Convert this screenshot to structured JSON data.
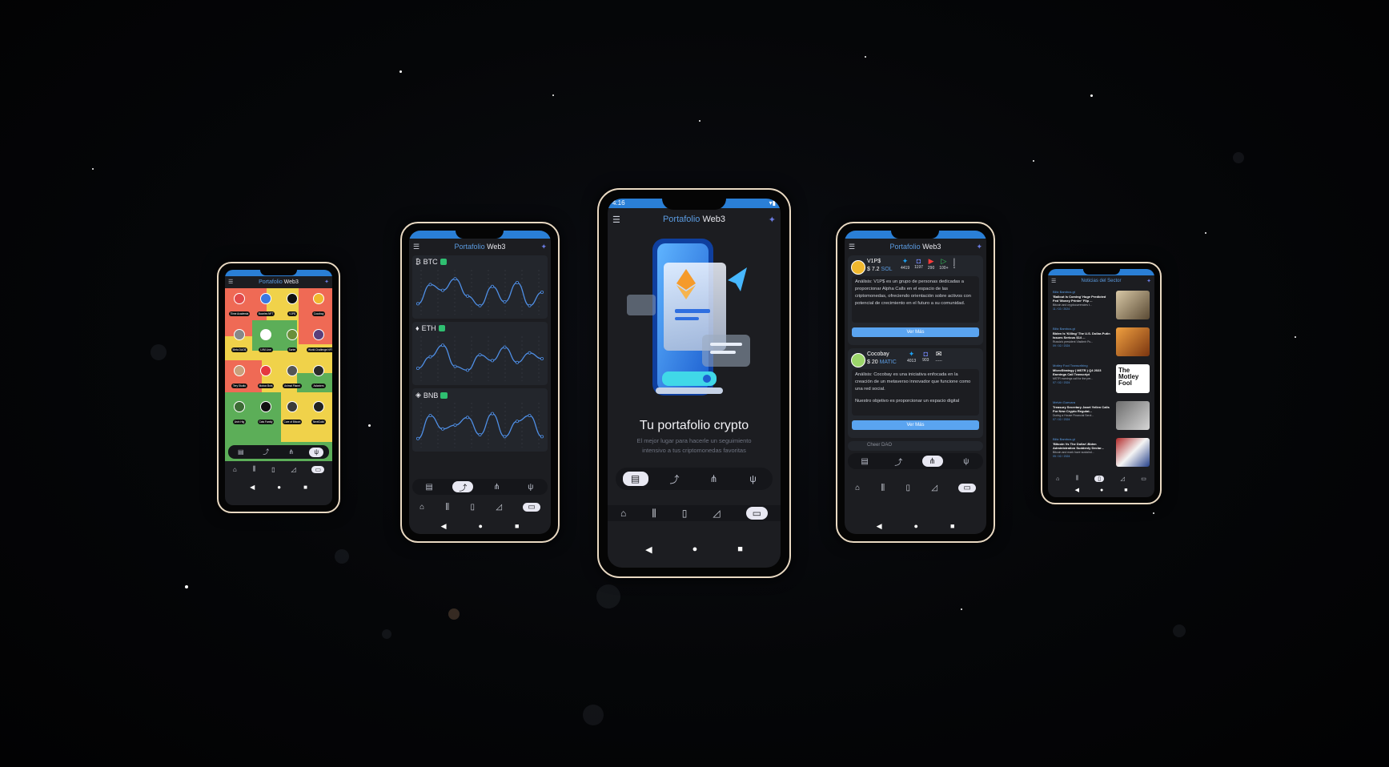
{
  "app": {
    "title_part1": "Portafolio",
    "title_part2": "Web3"
  },
  "phone_left": {
    "nfts": [
      {
        "name": "Tiime Academia"
      },
      {
        "name": "Boonies NFT"
      },
      {
        "name": "V1P$"
      },
      {
        "name": "Cocobay"
      },
      {
        "name": "Meta DAO$"
      },
      {
        "name": "LVM Line"
      },
      {
        "name": "Sorter"
      },
      {
        "name": "World Challenge NFT"
      },
      {
        "name": "Tery Studio"
      },
      {
        "name": "Mobox Bots"
      },
      {
        "name": "Animal Planet"
      },
      {
        "name": "Aslaniers"
      },
      {
        "name": "Arch Hig"
      },
      {
        "name": "Cats Family"
      },
      {
        "name": "Core of Bitcoin"
      },
      {
        "name": "NextGuild"
      }
    ]
  },
  "phone_charts": {
    "coins": [
      {
        "symbol": "BTC",
        "glyph": "₿"
      },
      {
        "symbol": "ETH",
        "glyph": "♦"
      },
      {
        "symbol": "BNB",
        "glyph": "◈"
      }
    ]
  },
  "phone_center": {
    "time": "4:16",
    "heading": "Tu portafolio crypto",
    "subtitle_line1": "El mejor lugar para hacerle un seguimiento",
    "subtitle_line2": "intensivo a tus criptomonedas favoritas"
  },
  "phone_projects": {
    "projects": [
      {
        "name": "V1P$",
        "price": "$ 7.2",
        "chain": "SOL",
        "twitter": "4419",
        "discord": "1197",
        "youtube": "290",
        "play": "100+",
        "extra": "1",
        "description": "Análisis: V1P$ es un grupo de personas dedicadas a proporcionar Alpha Calls en el espacio de las criptomonedas, ofreciendo orientación sobre activos con potencial de crecimiento en el futuro a su comunidad."
      },
      {
        "name": "Cocobay",
        "price": "$ 20",
        "chain": "MATIC",
        "twitter": "4013",
        "discord": "903",
        "email": "-----",
        "description": "Análisis: Cocobay es una iniciativa enfocada en la creación de un metaverso innovador que funcione como una red social.",
        "description2": "Nuestro objetivo es proporcionar un espacio digital"
      }
    ],
    "more_label": "Ver Más",
    "peek_label": "Cheer DAO"
  },
  "phone_news": {
    "title": "Noticias del Sector",
    "items": [
      {
        "source": "Blitz Bambus.gt",
        "title": "'Bailout Is Coming' Huge Predicted Fed 'Money Printer' Flip ...",
        "sub": "Bitcoin and cryptocurrencies t...",
        "date": "11 / 02 / 2024"
      },
      {
        "source": "Blitz Bambus.gt",
        "title": "Biden Is 'Killing' The U.S. Dollar-Putin Issues Serious $14 ...",
        "sub": "Russia's president Vladimir Pu...",
        "date": "09 / 02 / 2024"
      },
      {
        "source": "Motley Fool Transcribing",
        "title": "MicroStrategy ( MSTR ) Q4 2023 Earnings Call Transcript",
        "sub": "MSTR earnings call for the per...",
        "date": "07 / 02 / 2024"
      },
      {
        "source": "Melvin Guevara",
        "title": "Treasury Secretary Janet Yellen Calls For New Crypto Regulat...",
        "sub": "During a House Financial Servi...",
        "date": "07 / 02 / 2024"
      },
      {
        "source": "Blitz Bambus.gt",
        "title": "'Bitcoin Vs The Dollar'-Biden Administration Suddenly Declar...",
        "sub": "Bitcoin and mark have sustaind...",
        "date": "05 / 02 / 2024"
      }
    ],
    "thumb_fool_text": "The Motley Fool"
  }
}
